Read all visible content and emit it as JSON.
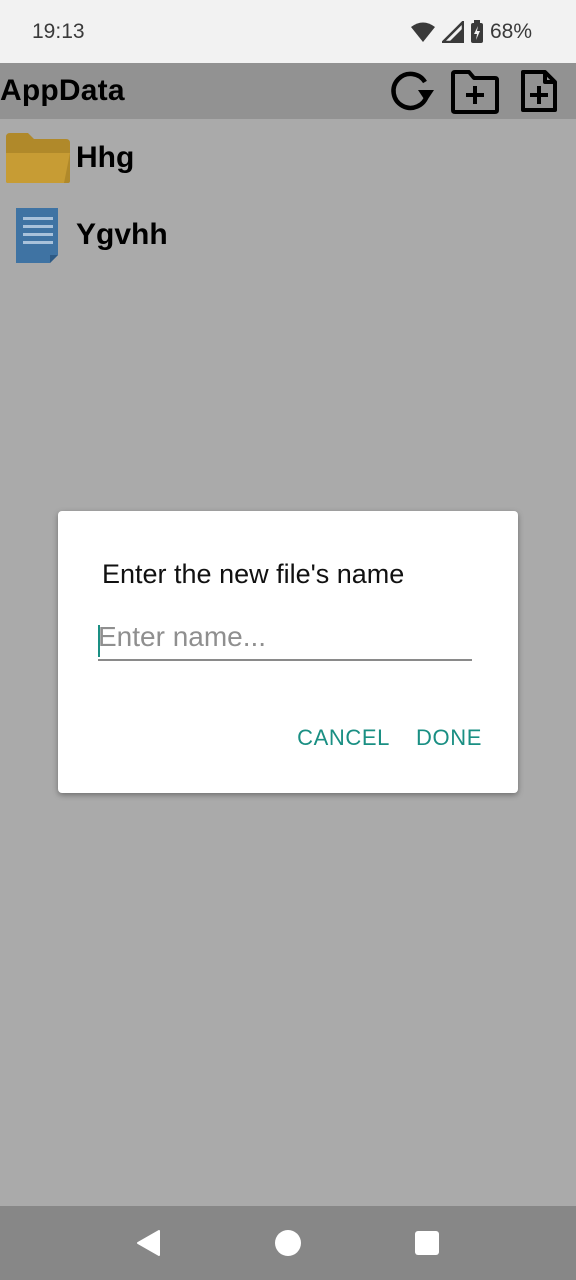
{
  "status_bar": {
    "time": "19:13",
    "battery": "68%",
    "icons": [
      "wifi-icon",
      "cell-signal-icon",
      "battery-charging-icon"
    ]
  },
  "toolbar": {
    "title": "AppData",
    "actions": [
      "refresh-icon",
      "new-folder-icon",
      "new-file-icon"
    ]
  },
  "files": [
    {
      "name": "Hhg",
      "type": "folder",
      "icon": "folder-icon"
    },
    {
      "name": "Ygvhh",
      "type": "file",
      "icon": "document-icon"
    }
  ],
  "dialog": {
    "title": "Enter the new file's name",
    "input_placeholder": "Enter name...",
    "input_value": "",
    "cancel_label": "CANCEL",
    "done_label": "DONE"
  },
  "nav": {
    "icons": [
      "back-icon",
      "home-icon",
      "recents-icon"
    ]
  },
  "colors": {
    "accent": "#1a8f83",
    "folder": "#b8922e",
    "document": "#3f73a3",
    "toolbar": "#929292",
    "background": "#aaaaaa"
  }
}
